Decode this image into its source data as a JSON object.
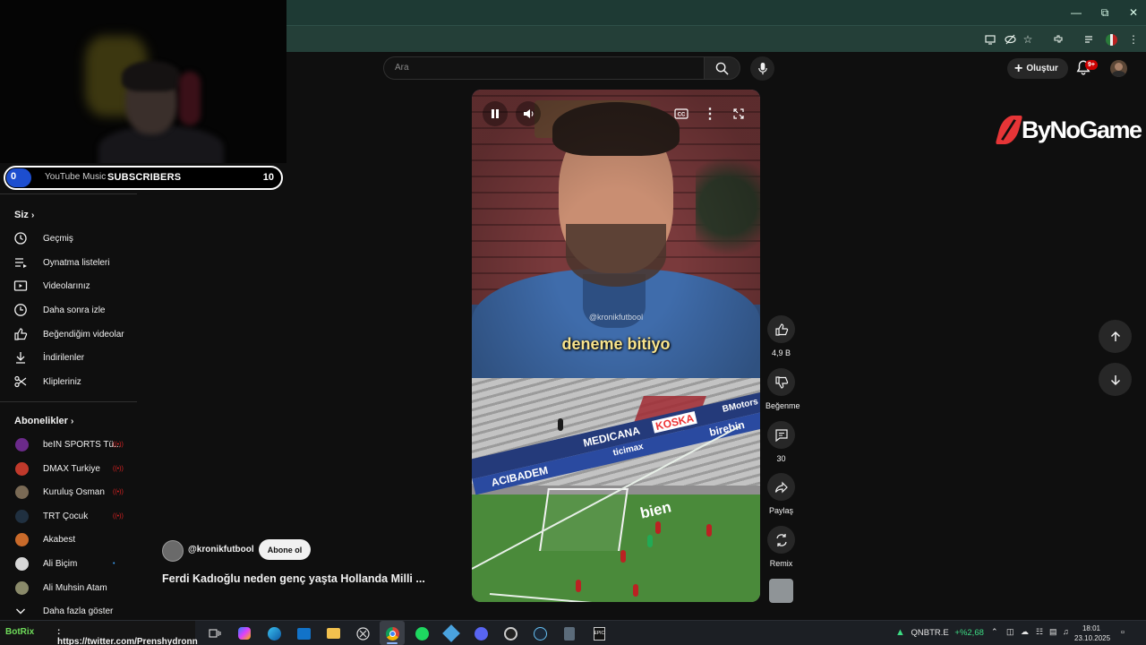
{
  "window": {
    "controls": [
      "minimize",
      "restore",
      "close"
    ]
  },
  "stream_overlay": {
    "subscriber_goal": {
      "current": "0",
      "source": "YouTube Music",
      "label": "SUBSCRIBERS",
      "goal": "10",
      "progress": 0.0
    }
  },
  "search": {
    "placeholder": "Ara"
  },
  "header": {
    "create_label": "Oluştur",
    "notification_count": "9+"
  },
  "brand_logo": "ByNoGame",
  "sidebar": {
    "you_heading": "Siz",
    "you_items": [
      {
        "label": "Geçmiş",
        "icon": "history-icon"
      },
      {
        "label": "Oynatma listeleri",
        "icon": "playlist-icon"
      },
      {
        "label": "Videolarınız",
        "icon": "your-videos-icon"
      },
      {
        "label": "Daha sonra izle",
        "icon": "watch-later-icon"
      },
      {
        "label": "Beğendiğim videolar",
        "icon": "liked-icon"
      },
      {
        "label": "İndirilenler",
        "icon": "download-icon"
      },
      {
        "label": "Klipleriniz",
        "icon": "scissors-icon"
      }
    ],
    "subs_heading": "Abonelikler",
    "subscriptions": [
      {
        "label": "beIN SPORTS Tü...",
        "color": "#6b2a8a",
        "live": true
      },
      {
        "label": "DMAX Turkiye",
        "color": "#c0392b",
        "live": true
      },
      {
        "label": "Kuruluş Osman",
        "color": "#7a6a55",
        "live": true
      },
      {
        "label": "TRT Çocuk",
        "color": "#203040",
        "live": true
      },
      {
        "label": "Akabest",
        "color": "#c96a2a",
        "live": false
      },
      {
        "label": "Ali Biçim",
        "color": "#d7d7d7",
        "live": false,
        "new": true
      },
      {
        "label": "Ali Muhsin Atam",
        "color": "#8a8a6a",
        "live": false
      }
    ],
    "show_more": "Daha fazla göster"
  },
  "video": {
    "watermark": "@kronikfutbool",
    "caption": "deneme bitiyo",
    "ad_boards": [
      "MEDICANA",
      "KOSKA",
      "BMotors",
      "ACIBADEM",
      "ticimax",
      "birebin",
      "bien"
    ]
  },
  "actions": {
    "like_count": "4,9 B",
    "dislike_label": "Beğenme",
    "comment_count": "30",
    "share_label": "Paylaş",
    "remix_label": "Remix"
  },
  "channel": {
    "handle": "@kronikfutbool",
    "subscribe_label": "Abone ol",
    "title": "Ferdi Kadıoğlu neden genç yaşta Hollanda Milli ..."
  },
  "taskbar": {
    "bot_name": "BotRix",
    "ticker_text": ": https://twitter.com/Prenshydronn",
    "stock_symbol": "QNBTR.E",
    "stock_change": "+%2,68",
    "time": "18:01",
    "date": "23.10.2025"
  },
  "colors": {
    "accent_red": "#cc0000",
    "stock_green": "#3ddc84",
    "subbar_blue": "#1d4ecf"
  }
}
